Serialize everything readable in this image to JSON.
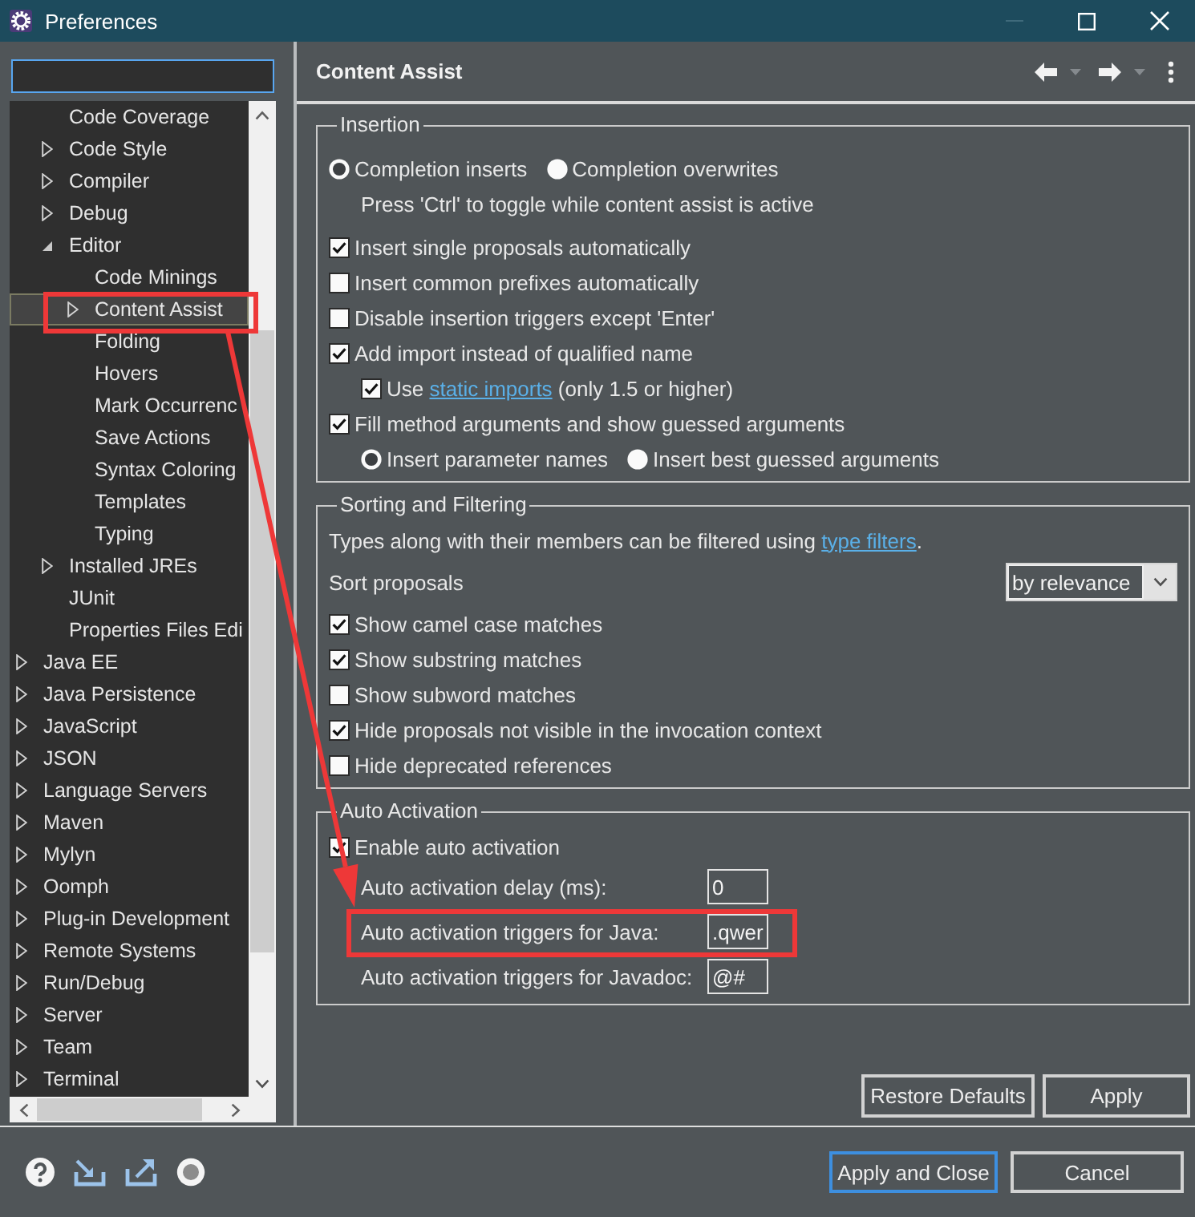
{
  "window": {
    "title": "Preferences",
    "controls": [
      {
        "kind": "minimize",
        "disabled": true
      },
      {
        "kind": "maximize",
        "disabled": false
      },
      {
        "kind": "close",
        "disabled": false
      }
    ]
  },
  "tree": {
    "items": [
      {
        "children": [
          {
            "label": "Code Coverage",
            "selected": false,
            "highlighted": false
          },
          {
            "label": "Code Style",
            "expanded": false,
            "selected": false,
            "highlighted": false
          },
          {
            "label": "Compiler",
            "expanded": false,
            "selected": false,
            "highlighted": false
          },
          {
            "label": "Debug",
            "expanded": false,
            "selected": false,
            "highlighted": false
          },
          {
            "label": "Editor",
            "expanded": true,
            "selected": false,
            "highlighted": false,
            "children": [
              {
                "label": "Code Minings",
                "selected": false,
                "highlighted": false
              },
              {
                "label": "Content Assist",
                "expanded": false,
                "selected": true,
                "highlighted": true
              },
              {
                "label": "Folding",
                "selected": false,
                "highlighted": false
              },
              {
                "label": "Hovers",
                "selected": false,
                "highlighted": false
              },
              {
                "label": "Mark Occurrenc",
                "selected": false,
                "highlighted": false
              },
              {
                "label": "Save Actions",
                "selected": false,
                "highlighted": false
              },
              {
                "label": "Syntax Coloring",
                "selected": false,
                "highlighted": false
              },
              {
                "label": "Templates",
                "selected": false,
                "highlighted": false
              },
              {
                "label": "Typing",
                "selected": false,
                "highlighted": false
              }
            ]
          },
          {
            "label": "Installed JREs",
            "expanded": false,
            "selected": false,
            "highlighted": false
          },
          {
            "label": "JUnit",
            "selected": false,
            "highlighted": false
          },
          {
            "label": "Properties Files Edi",
            "selected": false,
            "highlighted": false
          }
        ]
      },
      {
        "label": "Java EE",
        "expanded": false,
        "selected": false,
        "highlighted": false
      },
      {
        "label": "Java Persistence",
        "expanded": false,
        "selected": false,
        "highlighted": false
      },
      {
        "label": "JavaScript",
        "expanded": false,
        "selected": false,
        "highlighted": false
      },
      {
        "label": "JSON",
        "expanded": false,
        "selected": false,
        "highlighted": false
      },
      {
        "label": "Language Servers",
        "expanded": false,
        "selected": false,
        "highlighted": false
      },
      {
        "label": "Maven",
        "expanded": false,
        "selected": false,
        "highlighted": false
      },
      {
        "label": "Mylyn",
        "expanded": false,
        "selected": false,
        "highlighted": false
      },
      {
        "label": "Oomph",
        "expanded": false,
        "selected": false,
        "highlighted": false
      },
      {
        "label": "Plug-in Development",
        "expanded": false,
        "selected": false,
        "highlighted": false
      },
      {
        "label": "Remote Systems",
        "expanded": false,
        "selected": false,
        "highlighted": false
      },
      {
        "label": "Run/Debug",
        "expanded": false,
        "selected": false,
        "highlighted": false
      },
      {
        "label": "Server",
        "expanded": false,
        "selected": false,
        "highlighted": false
      },
      {
        "label": "Team",
        "expanded": false,
        "selected": false,
        "highlighted": false
      },
      {
        "label": "Terminal",
        "expanded": false,
        "selected": false,
        "highlighted": false
      }
    ]
  },
  "page": {
    "title": "Content Assist",
    "groups": [
      {
        "title": "Insertion",
        "rows": [
          {
            "kind": "radios",
            "options": [
              {
                "label": "Completion inserts",
                "selected": true
              },
              {
                "label": "Completion overwrites",
                "selected": false
              }
            ],
            "children": [
              {
                "kind": "note",
                "text": "Press 'Ctrl' to toggle while content assist is active"
              }
            ]
          },
          {
            "kind": "checkbox",
            "label": "Insert single proposals automatically",
            "checked": true
          },
          {
            "kind": "checkbox",
            "label": "Insert common prefixes automatically",
            "checked": false
          },
          {
            "kind": "checkbox",
            "label": "Disable insertion triggers except 'Enter'",
            "checked": false
          },
          {
            "kind": "checkbox",
            "label": "Add import instead of qualified name",
            "checked": true,
            "children": [
              {
                "kind": "checkbox",
                "label": "Use ",
                "link": "static imports",
                "label_end": " (only 1.5 or higher)",
                "checked": true
              }
            ]
          },
          {
            "kind": "checkbox",
            "label": "Fill method arguments and show guessed arguments",
            "checked": true,
            "children": [
              {
                "kind": "radios",
                "options": [
                  {
                    "label": "Insert parameter names",
                    "selected": true
                  },
                  {
                    "label": "Insert best guessed arguments",
                    "selected": false
                  }
                ]
              }
            ]
          }
        ]
      },
      {
        "title": "Sorting and Filtering",
        "rows": [
          {
            "kind": "note",
            "text": "Types along with their members can be filtered using ",
            "link": "type filters",
            "text_end": "."
          },
          {
            "kind": "select",
            "label": "Sort proposals",
            "value": "by relevance"
          },
          {
            "kind": "checkbox",
            "label": "Show camel case matches",
            "checked": true
          },
          {
            "kind": "checkbox",
            "label": "Show substring matches",
            "checked": true
          },
          {
            "kind": "checkbox",
            "label": "Show subword matches",
            "checked": false
          },
          {
            "kind": "checkbox",
            "label": "Hide proposals not visible in the invocation context",
            "checked": true
          },
          {
            "kind": "checkbox",
            "label": "Hide deprecated references",
            "checked": false
          }
        ]
      },
      {
        "title": "Auto Activation",
        "rows": [
          {
            "kind": "checkbox",
            "label": "Enable auto activation",
            "checked": true,
            "children": [
              {
                "kind": "field",
                "label": "Auto activation delay (ms):",
                "value": "0",
                "highlighted": false
              },
              {
                "kind": "field",
                "label": "Auto activation triggers for Java:",
                "value": ".qwer",
                "highlighted": true
              },
              {
                "kind": "field",
                "label": "Auto activation triggers for Javadoc:",
                "value": "@#",
                "highlighted": false
              }
            ]
          }
        ]
      }
    ],
    "buttons": [
      {
        "label": "Restore Defaults"
      },
      {
        "label": "Apply"
      }
    ]
  },
  "footer": {
    "buttons": [
      {
        "label": "Apply and Close",
        "default": true
      },
      {
        "label": "Cancel",
        "default": false
      }
    ]
  },
  "annotations": [
    {
      "kind": "arrow"
    }
  ]
}
